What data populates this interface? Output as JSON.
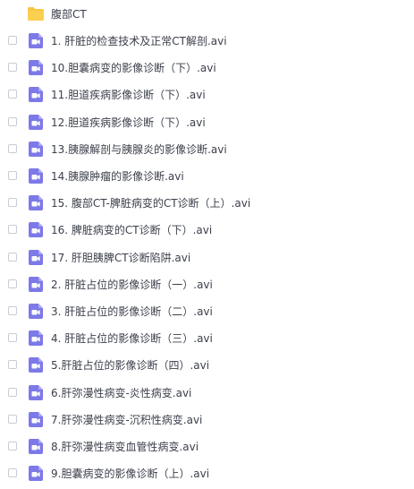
{
  "folder": {
    "name": "腹部CT",
    "icon": "folder-icon"
  },
  "files": [
    {
      "name": "1. 肝脏的检查技术及正常CT解剖.avi",
      "icon": "video-file-icon"
    },
    {
      "name": "10.胆囊病变的影像诊断（下）.avi",
      "icon": "video-file-icon"
    },
    {
      "name": "11.胆道疾病影像诊断（下）.avi",
      "icon": "video-file-icon"
    },
    {
      "name": "12.胆道疾病影像诊断（下）.avi",
      "icon": "video-file-icon"
    },
    {
      "name": "13.胰腺解剖与胰腺炎的影像诊断.avi",
      "icon": "video-file-icon"
    },
    {
      "name": "14.胰腺肿瘤的影像诊断.avi",
      "icon": "video-file-icon"
    },
    {
      "name": "15. 腹部CT-脾脏病变的CT诊断（上）.avi",
      "icon": "video-file-icon"
    },
    {
      "name": "16. 脾脏病变的CT诊断（下）.avi",
      "icon": "video-file-icon"
    },
    {
      "name": "17. 肝胆胰脾CT诊断陷阱.avi",
      "icon": "video-file-icon"
    },
    {
      "name": "2. 肝脏占位的影像诊断（一）.avi",
      "icon": "video-file-icon"
    },
    {
      "name": "3. 肝脏占位的影像诊断（二）.avi",
      "icon": "video-file-icon"
    },
    {
      "name": "4. 肝脏占位的影像诊断（三）.avi",
      "icon": "video-file-icon"
    },
    {
      "name": "5.肝脏占位的影像诊断（四）.avi",
      "icon": "video-file-icon"
    },
    {
      "name": "6.肝弥漫性病变-炎性病变.avi",
      "icon": "video-file-icon"
    },
    {
      "name": "7.肝弥漫性病变-沉积性病变.avi",
      "icon": "video-file-icon"
    },
    {
      "name": "8.肝弥漫性病变血管性病变.avi",
      "icon": "video-file-icon"
    },
    {
      "name": "9.胆囊病变的影像诊断（上）.avi",
      "icon": "video-file-icon"
    }
  ],
  "colors": {
    "folder": "#f7c744",
    "video_icon": "#7d79e8",
    "text": "#3b3f4a",
    "checkbox_border": "#c8ccd4"
  }
}
